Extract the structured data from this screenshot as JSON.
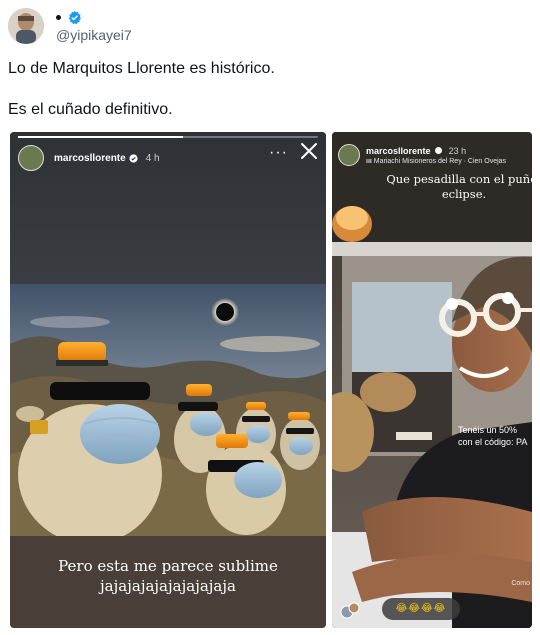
{
  "tweet": {
    "handle": "@yipikayei7",
    "text_line1": "Lo de Marquitos Llorente es histórico.",
    "text_line2": "Es el cuñado definitivo."
  },
  "story1": {
    "username": "marcosllorente",
    "time": "4 h",
    "more_label": "···",
    "progress": 0.55,
    "caption_line1": "Pero esta me parece sublime",
    "caption_line2": "jajajajajajajajajaja"
  },
  "story2": {
    "username": "marcosllorente",
    "time": "23 h",
    "music": "Mariachi Misioneros del Rey · Cien Ovejas",
    "overlay_line1": "Que pesadilla con el puñet",
    "overlay_line2": "eclipse.",
    "promo_line1": "Tenéis un 50%",
    "promo_line2": "con el código: PA",
    "footer": "Como",
    "emoji_bar": "😂😂😂😂"
  },
  "icons": {
    "verified": "verified-badge-icon",
    "close": "close-icon",
    "more": "more-options-icon"
  },
  "colors": {
    "verified_blue": "#1d9bf0",
    "handle_gray": "#536471"
  }
}
